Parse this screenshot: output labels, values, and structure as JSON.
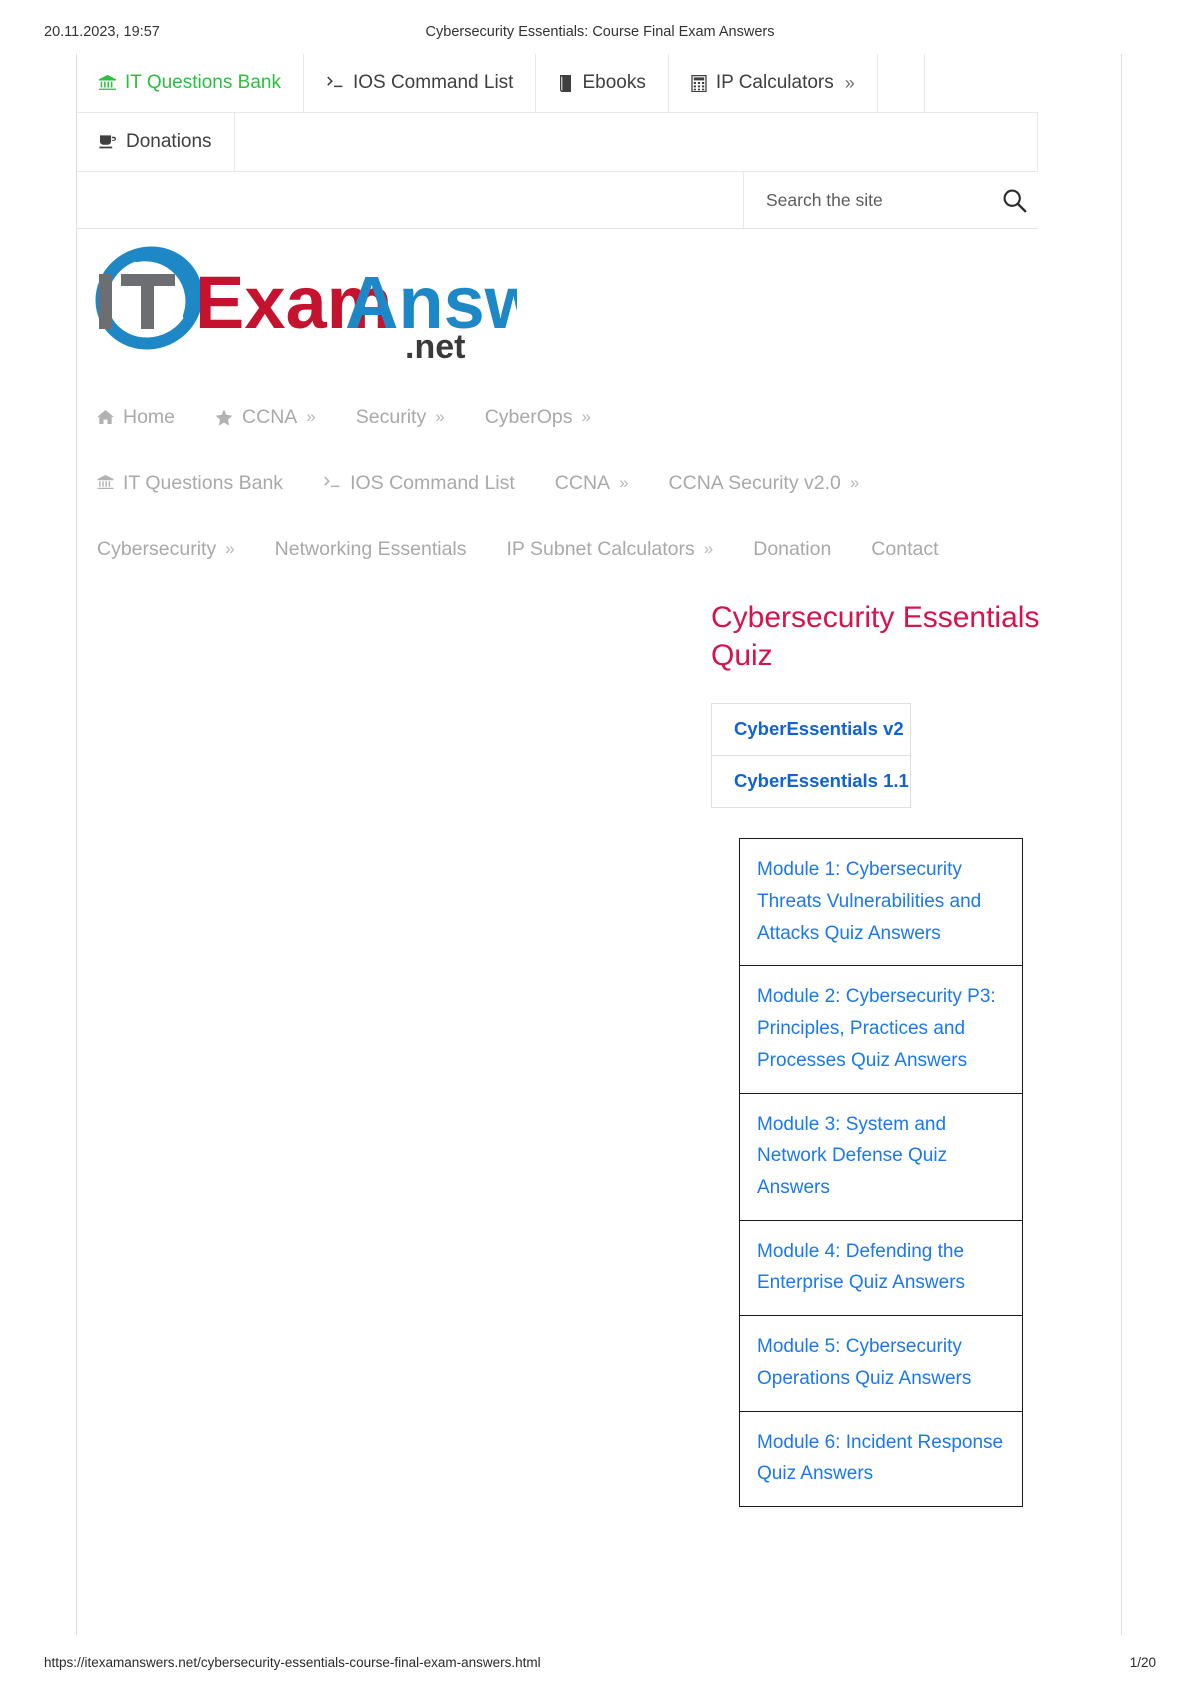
{
  "print_header": {
    "date": "20.11.2023, 19:57",
    "title": "Cybersecurity Essentials: Course Final Exam Answers"
  },
  "topnav": {
    "rows": [
      [
        {
          "icon": "bank-icon",
          "glyph": "🏛",
          "label": "IT Questions Bank",
          "accent": true,
          "chevron": ""
        },
        {
          "icon": "terminal-icon",
          "glyph": ">_",
          "label": "IOS Command List",
          "accent": false,
          "chevron": ""
        },
        {
          "icon": "book-icon",
          "glyph": "📕",
          "label": "Ebooks",
          "accent": false,
          "chevron": ""
        },
        {
          "icon": "calculator-icon",
          "glyph": "⌸",
          "label": "IP Calculators",
          "accent": false,
          "chevron": "»"
        }
      ],
      [
        {
          "icon": "coffee-cup-icon",
          "glyph": "☕",
          "label": "Donations",
          "accent": false,
          "chevron": ""
        }
      ]
    ]
  },
  "search": {
    "placeholder": "Search the site",
    "value": "",
    "icon": "search-icon"
  },
  "logo": {
    "it": "IT",
    "exam": "Exam",
    "answers": "Answers",
    "dotnet": ".net",
    "colors": {
      "it": "#6d6e71",
      "swoosh": "#1e88c7",
      "exam": "#c4122f",
      "answers": "#1e88c7",
      "dotnet": "#3a3a3a"
    }
  },
  "mainnav": {
    "rows": [
      [
        {
          "icon": "home-icon",
          "glyph": "⌂",
          "label": "Home",
          "chevron": ""
        },
        {
          "icon": "star-icon",
          "glyph": "★",
          "label": "CCNA",
          "chevron": "»"
        },
        {
          "icon": "",
          "glyph": "",
          "label": "Security",
          "chevron": "»"
        },
        {
          "icon": "",
          "glyph": "",
          "label": "CyberOps",
          "chevron": "»"
        }
      ],
      [
        {
          "icon": "bank-icon",
          "glyph": "🏛",
          "label": "IT Questions Bank",
          "chevron": ""
        },
        {
          "icon": "terminal-icon",
          "glyph": ">_",
          "label": "IOS Command List",
          "chevron": ""
        },
        {
          "icon": "",
          "glyph": "",
          "label": "CCNA",
          "chevron": "»"
        },
        {
          "icon": "",
          "glyph": "",
          "label": "CCNA Security v2.0",
          "chevron": "»"
        }
      ],
      [
        {
          "icon": "",
          "glyph": "",
          "label": "Cybersecurity",
          "chevron": "»"
        },
        {
          "icon": "",
          "glyph": "",
          "label": "Networking Essentials",
          "chevron": ""
        },
        {
          "icon": "",
          "glyph": "",
          "label": "IP Subnet Calculators",
          "chevron": "»"
        },
        {
          "icon": "",
          "glyph": "",
          "label": "Donation",
          "chevron": ""
        },
        {
          "icon": "",
          "glyph": "",
          "label": "Contact",
          "chevron": ""
        }
      ]
    ]
  },
  "sidebar": {
    "title": "Cybersecurity Essentials Quiz",
    "title_color": "#d8124c",
    "link_color": "#1b78ef",
    "tabs": [
      {
        "label": "CyberEssentials v2",
        "active": true
      },
      {
        "label": "CyberEssentials 1.1",
        "active": false
      }
    ],
    "modules": [
      {
        "label": "Module 1: Cybersecurity Threats Vulnerabilities and Attacks Quiz Answers"
      },
      {
        "label": "Module 2: Cybersecurity P3: Principles, Practices and Processes Quiz Answers"
      },
      {
        "label": "Module 3: System and Network Defense Quiz Answers"
      },
      {
        "label": "Module 4: Defending the Enterprise Quiz Answers"
      },
      {
        "label": "Module 5: Cybersecurity Operations Quiz Answers"
      },
      {
        "label": "Module 6: Incident Response Quiz Answers"
      }
    ]
  },
  "print_footer": {
    "url": "https://itexamanswers.net/cybersecurity-essentials-course-final-exam-answers.html",
    "page": "1/20"
  }
}
